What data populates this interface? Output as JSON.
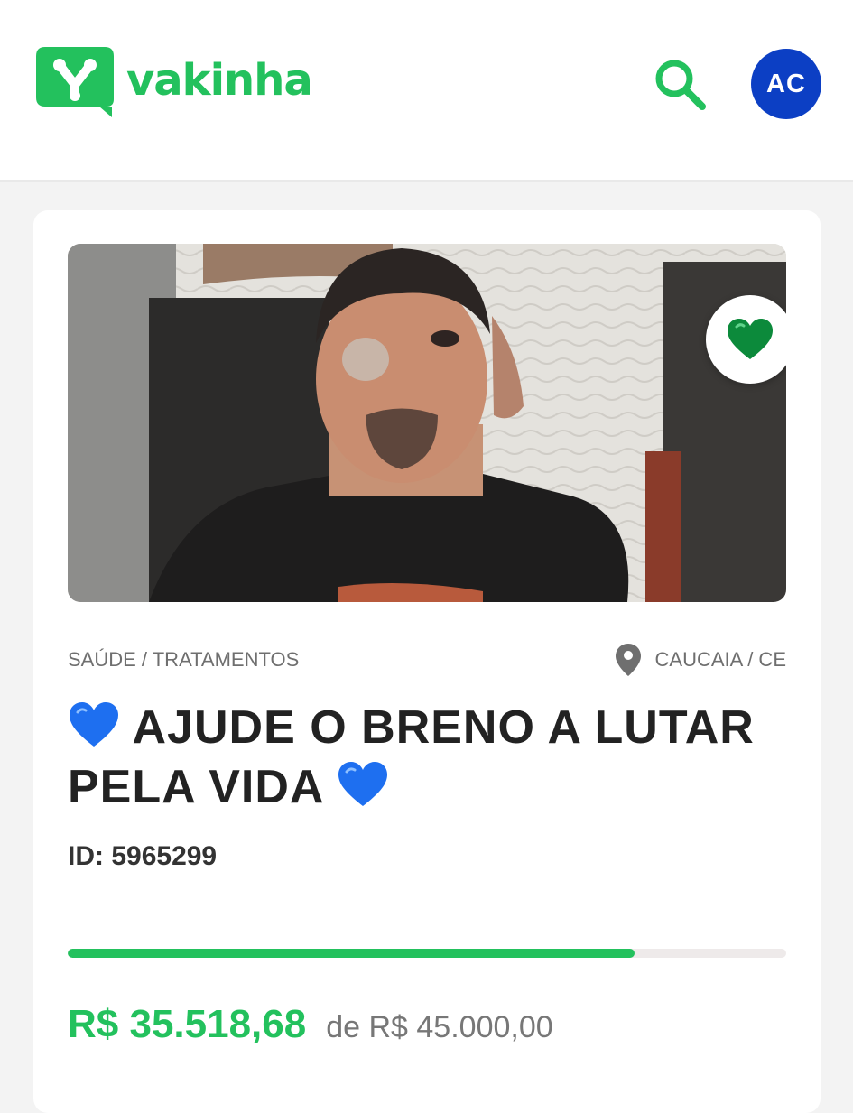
{
  "header": {
    "logo_text": "vakinha",
    "brand_color": "#23c15d",
    "search_icon": "search-icon",
    "avatar_initials": "AC",
    "avatar_color": "#0c3fc4"
  },
  "campaign": {
    "category": "SAÚDE / TRATAMENTOS",
    "location": "CAUCAIA / CE",
    "title_lead_emoji": "blue-heart-icon",
    "title_text": "AJUDE O BRENO A LUTAR PELA VIDA",
    "title_trail_emoji": "blue-heart-icon",
    "id_label": "ID: 5965299",
    "favorite_icon": "green-heart-icon",
    "progress_percent": 78.9,
    "raised": "R$ 35.518,68",
    "goal": "de R$ 45.000,00"
  }
}
